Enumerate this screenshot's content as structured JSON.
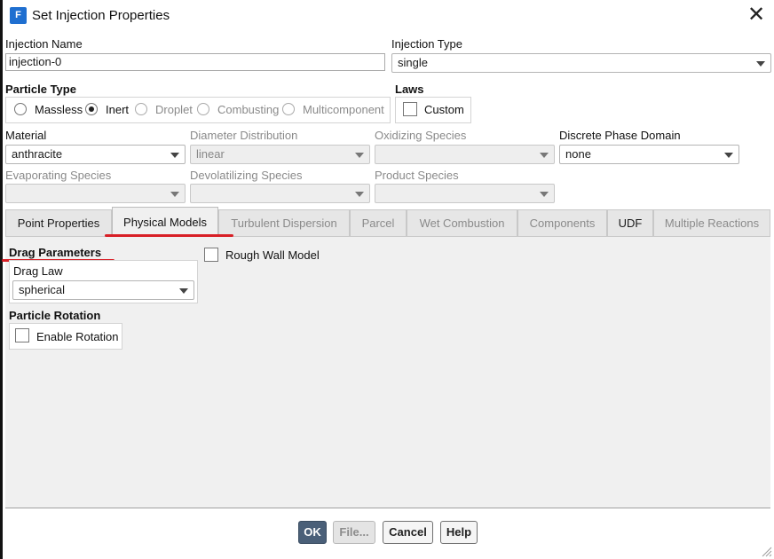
{
  "window": {
    "title": "Set Injection Properties",
    "app_icon_letter": "F",
    "close_glyph": "✕"
  },
  "injection_name": {
    "label": "Injection Name",
    "value": "injection-0"
  },
  "injection_type": {
    "label": "Injection Type",
    "value": "single"
  },
  "particle_type": {
    "label": "Particle Type",
    "options": [
      {
        "label": "Massless",
        "selected": false,
        "enabled": true
      },
      {
        "label": "Inert",
        "selected": true,
        "enabled": true
      },
      {
        "label": "Droplet",
        "selected": false,
        "enabled": false
      },
      {
        "label": "Combusting",
        "selected": false,
        "enabled": false
      },
      {
        "label": "Multicomponent",
        "selected": false,
        "enabled": false
      }
    ]
  },
  "laws": {
    "label": "Laws",
    "custom_label": "Custom",
    "custom_checked": false
  },
  "fields": {
    "material": {
      "label": "Material",
      "value": "anthracite",
      "enabled": true
    },
    "diameter_distribution": {
      "label": "Diameter Distribution",
      "value": "linear",
      "enabled": false
    },
    "oxidizing_species": {
      "label": "Oxidizing Species",
      "value": "",
      "enabled": false
    },
    "discrete_phase_domain": {
      "label": "Discrete Phase Domain",
      "value": "none",
      "enabled": true
    },
    "evaporating_species": {
      "label": "Evaporating Species",
      "value": "",
      "enabled": false
    },
    "devolatilizing_species": {
      "label": "Devolatilizing Species",
      "value": "",
      "enabled": false
    },
    "product_species": {
      "label": "Product Species",
      "value": "",
      "enabled": false
    }
  },
  "tabs": [
    {
      "label": "Point Properties",
      "enabled": true,
      "active": false
    },
    {
      "label": "Physical Models",
      "enabled": true,
      "active": true
    },
    {
      "label": "Turbulent Dispersion",
      "enabled": false,
      "active": false
    },
    {
      "label": "Parcel",
      "enabled": false,
      "active": false
    },
    {
      "label": "Wet Combustion",
      "enabled": false,
      "active": false
    },
    {
      "label": "Components",
      "enabled": false,
      "active": false
    },
    {
      "label": "UDF",
      "enabled": true,
      "active": false
    },
    {
      "label": "Multiple Reactions",
      "enabled": false,
      "active": false
    }
  ],
  "physical_models": {
    "drag_parameters": {
      "label": "Drag Parameters",
      "drag_law_label": "Drag Law",
      "drag_law_value": "spherical"
    },
    "rough_wall": {
      "label": "Rough Wall Model",
      "checked": false
    },
    "particle_rotation": {
      "label": "Particle Rotation",
      "enable_label": "Enable Rotation",
      "checked": false
    }
  },
  "buttons": {
    "ok": {
      "label": "OK",
      "enabled": true
    },
    "file": {
      "label": "File...",
      "enabled": false
    },
    "cancel": {
      "label": "Cancel",
      "enabled": true
    },
    "help": {
      "label": "Help",
      "enabled": true
    }
  },
  "colors": {
    "annotation_red": "#d81f26",
    "ok_button": "#4a5f78",
    "panel_bg": "#f0f0f0"
  }
}
